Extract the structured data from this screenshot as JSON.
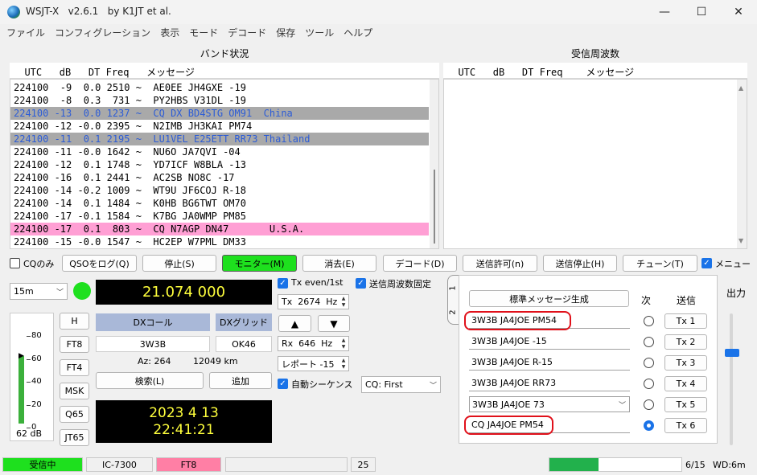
{
  "window": {
    "title": "WSJT-X   v2.6.1   by K1JT et al.",
    "minimize": "—",
    "maximize": "☐",
    "close": "✕"
  },
  "menu": [
    "ファイル",
    "コンフィグレーション",
    "表示",
    "モード",
    "デコード",
    "保存",
    "ツール",
    "ヘルプ"
  ],
  "band_activity": {
    "title": "バンド状況",
    "header": "  UTC   dB   DT Freq   メッセージ",
    "rows": [
      {
        "text": "224100  -9  0.0 2510 ~  AE0EE JH4GXE -19",
        "style": "normal"
      },
      {
        "text": "224100  -8  0.3  731 ~  PY2HBS V31DL -19",
        "style": "normal"
      },
      {
        "text": "224100 -13  0.0 1237 ~  CQ DX BD4STG OM91  China",
        "style": "cq"
      },
      {
        "text": "224100 -12 -0.0 2395 ~  N2IMB JH3KAI PM74",
        "style": "normal"
      },
      {
        "text": "224100 -11  0.1 2195 ~  LU1VEL E25ETT RR73 Thailand",
        "style": "cq"
      },
      {
        "text": "224100 -11 -0.0 1642 ~  NU6O JA7QVI -04",
        "style": "normal"
      },
      {
        "text": "224100 -12  0.1 1748 ~  YD7ICF W8BLA -13",
        "style": "normal"
      },
      {
        "text": "224100 -16  0.1 2441 ~  AC2SB NO8C -17",
        "style": "normal"
      },
      {
        "text": "224100 -14 -0.2 1009 ~  WT9U JF6COJ R-18",
        "style": "normal"
      },
      {
        "text": "224100 -14  0.1 1484 ~  K0HB BG6TWT OM70",
        "style": "normal"
      },
      {
        "text": "224100 -17 -0.1 1584 ~  K7BG JA0WMP PM85",
        "style": "normal"
      },
      {
        "text": "224100 -17  0.1  803 ~  CQ N7AGP DN47       U.S.A.",
        "style": "pink"
      },
      {
        "text": "224100 -15 -0.0 1547 ~  HC2EP W7PML DM33",
        "style": "normal"
      }
    ]
  },
  "rx_frequency": {
    "title": "受信周波数",
    "header": "  UTC   dB   DT Freq    メッセージ"
  },
  "controls": {
    "cq_only": "CQのみ",
    "log_qso": "QSOをログ(Q)",
    "stop": "停止(S)",
    "monitor": "モニター(M)",
    "erase": "消去(E)",
    "decode": "デコード(D)",
    "enable_tx": "送信許可(n)",
    "halt_tx": "送信停止(H)",
    "tune": "チューン(T)",
    "menus": "メニュー"
  },
  "left": {
    "band": "15m",
    "frequency": "21.074 000",
    "meter_ticks": [
      "80",
      "60",
      "40",
      "20",
      "0"
    ],
    "meter_db": "62 dB",
    "signal_level_fraction": 0.7,
    "mode_buttons": [
      "H",
      "FT8",
      "FT4",
      "MSK",
      "Q65",
      "JT65"
    ],
    "dx_call_label": "DXコール",
    "dx_grid_label": "DXグリッド",
    "dx_call": "3W3B",
    "dx_grid": "OK46",
    "az": "Az: 264",
    "dist": "12049 km",
    "lookup": "検索(L)",
    "add": "追加",
    "date": "2023 4 13",
    "time": "22:41:21"
  },
  "middle": {
    "tx_even": "Tx even/1st",
    "hold_tx_freq": "送信周波数固定",
    "tx_freq": "Tx  2674  Hz",
    "rx_freq": "Rx  646  Hz",
    "report": "レポート -15",
    "auto_seq": "自動シーケンス",
    "cq_combo": "CQ: First",
    "up_arrow": "▲",
    "down_arrow": "▼"
  },
  "tx_panel": {
    "tab1": "1",
    "tab2": "2",
    "generate": "標準メッセージ生成",
    "next_label": "次",
    "send_label": "送信",
    "messages": [
      {
        "text": "3W3B JA4JOE PM54",
        "tx": "Tx 1"
      },
      {
        "text": "3W3B JA4JOE -15",
        "tx": "Tx 2"
      },
      {
        "text": "3W3B JA4JOE R-15",
        "tx": "Tx 3"
      },
      {
        "text": "3W3B JA4JOE RR73",
        "tx": "Tx 4"
      },
      {
        "text": "3W3B JA4JOE 73",
        "tx": "Tx 5"
      },
      {
        "text": "CQ JA4JOE PM54",
        "tx": "Tx 6"
      }
    ],
    "power_label": "出力"
  },
  "status": {
    "receiving": "受信中",
    "rig": "IC-7300",
    "mode": "FT8",
    "tr_period": "25",
    "progress_fraction": 0.37,
    "count": "6/15",
    "wd": "WD:6m"
  }
}
